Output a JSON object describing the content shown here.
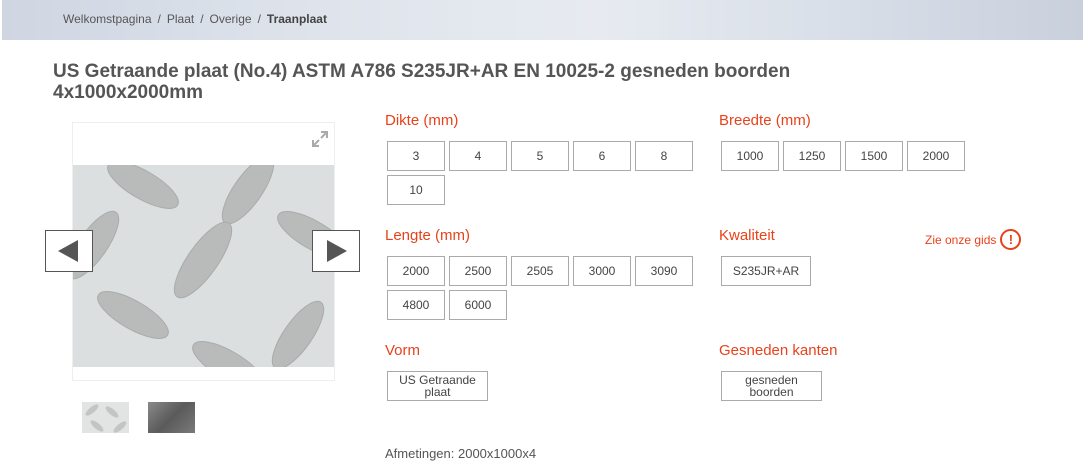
{
  "breadcrumb": [
    {
      "label": "Welkomstpagina",
      "current": false
    },
    {
      "label": "Plaat",
      "current": false
    },
    {
      "label": "Overige",
      "current": false
    },
    {
      "label": "Traanplaat",
      "current": true
    }
  ],
  "breadcrumb_separator": "/",
  "product": {
    "title": "US Getraande plaat (No.4) ASTM A786 S235JR+AR EN 10025-2 gesneden boorden 4x1000x2000mm",
    "dimensions_text": "Afmetingen: 2000x1000x4"
  },
  "icons": {
    "expand": "expand-icon",
    "prev": "arrow-left-icon",
    "next": "arrow-right-icon",
    "guide": "exclamation-circle-icon"
  },
  "options": {
    "dikte": {
      "label": "Dikte (mm)",
      "values": [
        "3",
        "4",
        "5",
        "6",
        "8",
        "10"
      ]
    },
    "breedte": {
      "label": "Breedte (mm)",
      "values": [
        "1000",
        "1250",
        "1500",
        "2000"
      ]
    },
    "lengte": {
      "label": "Lengte (mm)",
      "values": [
        "2000",
        "2500",
        "2505",
        "3000",
        "3090",
        "4800",
        "6000"
      ]
    },
    "kwaliteit": {
      "label": "Kwaliteit",
      "values": [
        "S235JR+AR"
      ]
    },
    "vorm": {
      "label": "Vorm",
      "values": [
        "US Getraande plaat"
      ]
    },
    "kanten": {
      "label": "Gesneden kanten",
      "values": [
        "gesneden boorden"
      ]
    }
  },
  "guide_link": "Zie onze gids",
  "colors": {
    "accent": "#e8421b",
    "text": "#555555",
    "border": "#aaaaaa"
  }
}
